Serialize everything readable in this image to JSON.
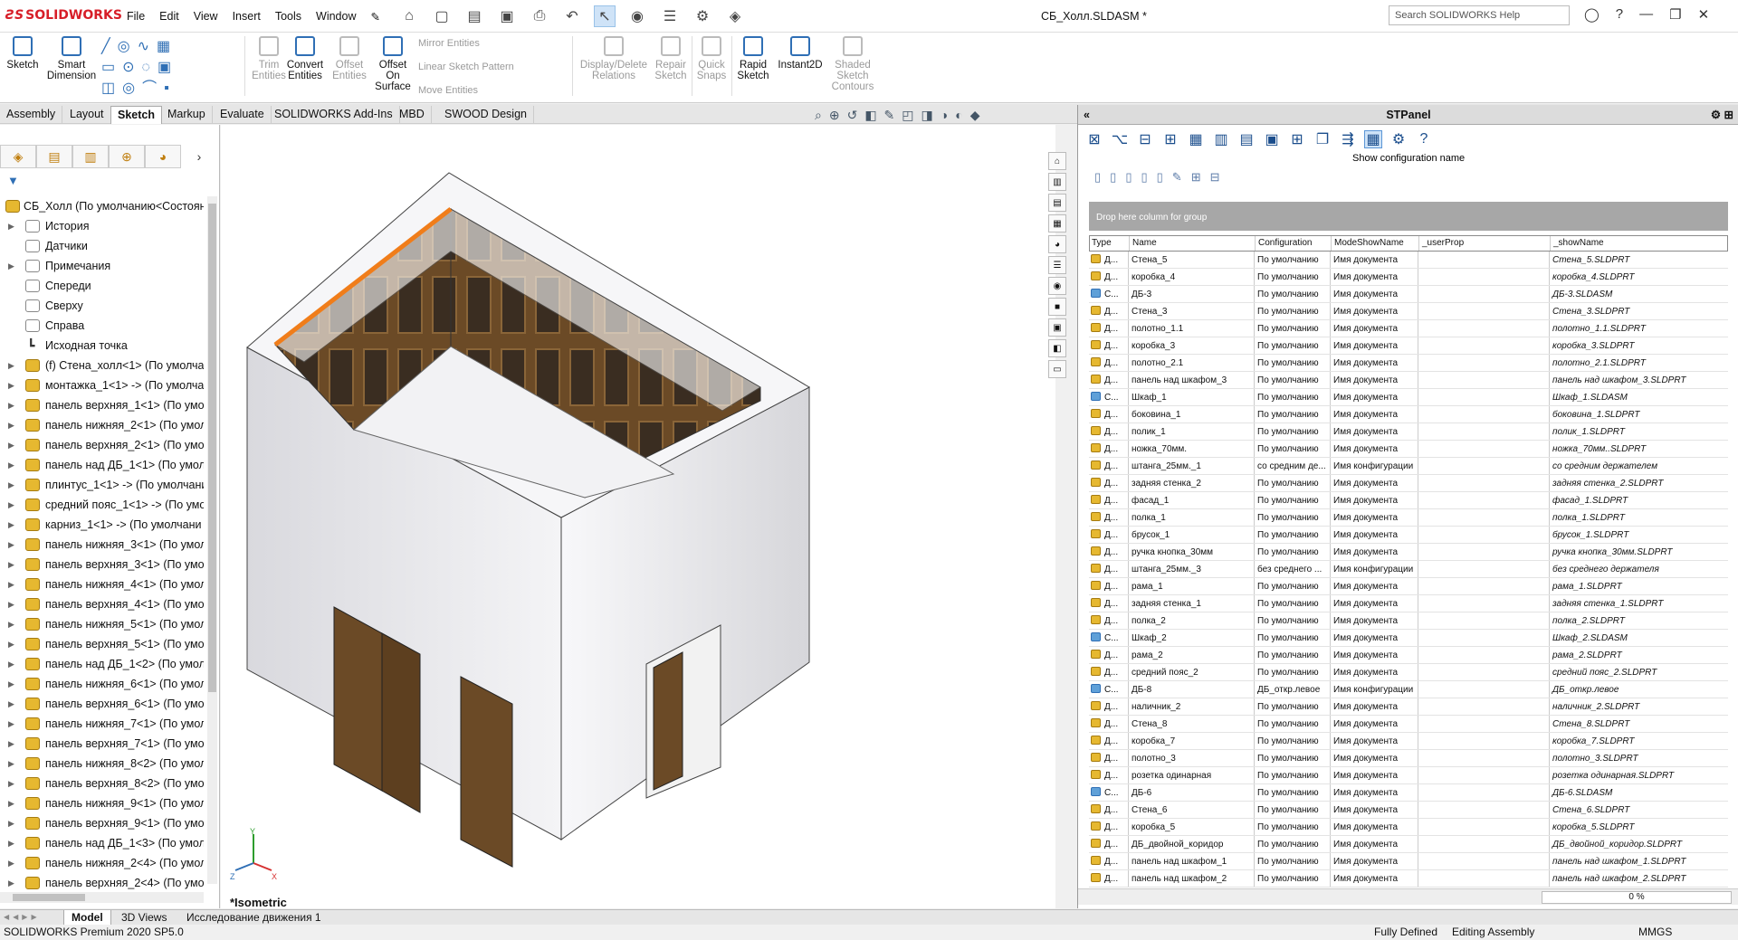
{
  "app": {
    "logo": "SOLIDWORKS",
    "title": "СБ_Холл.SLDASM *",
    "search_placeholder": "Search SOLIDWORKS Help"
  },
  "menu": [
    "File",
    "Edit",
    "View",
    "Insert",
    "Tools",
    "Window"
  ],
  "ribbon": {
    "sketch": "Sketch",
    "smart_dimension": "Smart Dimension",
    "trim": "Trim Entities",
    "convert": "Convert Entities",
    "offset": "Offset Entities",
    "offset_surface": "Offset On Surface",
    "mirror": "Mirror Entities",
    "linear_pattern": "Linear Sketch Pattern",
    "move": "Move Entities",
    "display_delete": "Display/Delete Relations",
    "repair": "Repair Sketch",
    "quick_snaps": "Quick Snaps",
    "rapid": "Rapid Sketch",
    "instant2d": "Instant2D",
    "shaded": "Shaded Sketch Contours"
  },
  "tabs": [
    "Assembly",
    "Layout",
    "Sketch",
    "Markup",
    "Evaluate",
    "SOLIDWORKS Add-Ins",
    "MBD",
    "SWOOD Design"
  ],
  "active_tab": "Sketch",
  "tree": {
    "root": "СБ_Холл  (По умолчанию<Состоян",
    "items": [
      {
        "label": "История",
        "icon": "history-icon",
        "exp": true
      },
      {
        "label": "Датчики",
        "icon": "sensor-icon",
        "exp": false
      },
      {
        "label": "Примечания",
        "icon": "annotations-icon",
        "exp": true
      },
      {
        "label": "Спереди",
        "icon": "plane-icon",
        "exp": false
      },
      {
        "label": "Сверху",
        "icon": "plane-icon",
        "exp": false
      },
      {
        "label": "Справа",
        "icon": "plane-icon",
        "exp": false
      },
      {
        "label": "Исходная точка",
        "icon": "origin-icon",
        "exp": false
      },
      {
        "label": "(f) Стена_холл<1> (По умолчан",
        "icon": "part-icon",
        "exp": true
      },
      {
        "label": "монтажка_1<1> -> (По умолча",
        "icon": "part-icon",
        "exp": true
      },
      {
        "label": "панель верхняя_1<1> (По умол",
        "icon": "part-icon",
        "exp": true
      },
      {
        "label": "панель нижняя_2<1> (По умол",
        "icon": "part-icon",
        "exp": true
      },
      {
        "label": "панель верхняя_2<1> (По умол",
        "icon": "part-icon",
        "exp": true
      },
      {
        "label": "панель над ДБ_1<1> (По умолч",
        "icon": "part-icon",
        "exp": true
      },
      {
        "label": "плинтус_1<1> -> (По умолчани",
        "icon": "part-icon",
        "exp": true
      },
      {
        "label": "средний пояс_1<1> -> (По умо.",
        "icon": "part-icon",
        "exp": true
      },
      {
        "label": "карниз_1<1> -> (По умолчани",
        "icon": "part-icon",
        "exp": true
      },
      {
        "label": "панель нижняя_3<1> (По умол",
        "icon": "part-icon",
        "exp": true
      },
      {
        "label": "панель верхняя_3<1> (По умол",
        "icon": "part-icon",
        "exp": true
      },
      {
        "label": "панель нижняя_4<1> (По умол",
        "icon": "part-icon",
        "exp": true
      },
      {
        "label": "панель верхняя_4<1> (По умол",
        "icon": "part-icon",
        "exp": true
      },
      {
        "label": "панель нижняя_5<1> (По умол",
        "icon": "part-icon",
        "exp": true
      },
      {
        "label": "панель верхняя_5<1> (По умол",
        "icon": "part-icon",
        "exp": true
      },
      {
        "label": "панель над ДБ_1<2> (По умолч",
        "icon": "part-icon",
        "exp": true
      },
      {
        "label": "панель нижняя_6<1> (По умол",
        "icon": "part-icon",
        "exp": true
      },
      {
        "label": "панель верхняя_6<1> (По умол",
        "icon": "part-icon",
        "exp": true
      },
      {
        "label": "панель нижняя_7<1> (По умол",
        "icon": "part-icon",
        "exp": true
      },
      {
        "label": "панель верхняя_7<1> (По умол",
        "icon": "part-icon",
        "exp": true
      },
      {
        "label": "панель нижняя_8<2> (По умол",
        "icon": "part-icon",
        "exp": true
      },
      {
        "label": "панель верхняя_8<2> (По умол",
        "icon": "part-icon",
        "exp": true
      },
      {
        "label": "панель нижняя_9<1> (По умол",
        "icon": "part-icon",
        "exp": true
      },
      {
        "label": "панель верхняя_9<1> (По умол",
        "icon": "part-icon",
        "exp": true
      },
      {
        "label": "панель над ДБ_1<3> (По умолч",
        "icon": "part-icon",
        "exp": true
      },
      {
        "label": "панель нижняя_2<4> (По умол",
        "icon": "part-icon",
        "exp": true
      },
      {
        "label": "панель верхняя_2<4> (По умол",
        "icon": "part-icon",
        "exp": true
      }
    ]
  },
  "viewport": {
    "view_label": "*Isometric",
    "axes": [
      "Y",
      "X",
      "Z"
    ]
  },
  "panel": {
    "title": "STPanel",
    "tooltip": "Show configuration name",
    "group_hint": "Drop here column for group",
    "columns": [
      "Type",
      "Name",
      "Configuration",
      "ModeShowName",
      "_userProp",
      "_showName"
    ],
    "rows": [
      {
        "t": "Д...",
        "a": false,
        "n": "Стена_5",
        "c": "По умолчанию",
        "m": "Имя документа",
        "s": "Стена_5.SLDPRT"
      },
      {
        "t": "Д...",
        "a": false,
        "n": "коробка_4",
        "c": "По умолчанию",
        "m": "Имя документа",
        "s": "коробка_4.SLDPRT"
      },
      {
        "t": "С...",
        "a": true,
        "n": "ДБ-3",
        "c": "По умолчанию",
        "m": "Имя документа",
        "s": "ДБ-3.SLDASM"
      },
      {
        "t": "Д...",
        "a": false,
        "n": "Стена_3",
        "c": "По умолчанию",
        "m": "Имя документа",
        "s": "Стена_3.SLDPRT"
      },
      {
        "t": "Д...",
        "a": false,
        "n": "полотно_1.1",
        "c": "По умолчанию",
        "m": "Имя документа",
        "s": "полотно_1.1.SLDPRT"
      },
      {
        "t": "Д...",
        "a": false,
        "n": "коробка_3",
        "c": "По умолчанию",
        "m": "Имя документа",
        "s": "коробка_3.SLDPRT"
      },
      {
        "t": "Д...",
        "a": false,
        "n": "полотно_2.1",
        "c": "По умолчанию",
        "m": "Имя документа",
        "s": "полотно_2.1.SLDPRT"
      },
      {
        "t": "Д...",
        "a": false,
        "n": "панель над шкафом_3",
        "c": "По умолчанию",
        "m": "Имя документа",
        "s": "панель над шкафом_3.SLDPRT"
      },
      {
        "t": "С...",
        "a": true,
        "n": "Шкаф_1",
        "c": "По умолчанию",
        "m": "Имя документа",
        "s": "Шкаф_1.SLDASM"
      },
      {
        "t": "Д...",
        "a": false,
        "n": "боковина_1",
        "c": "По умолчанию",
        "m": "Имя документа",
        "s": "боковина_1.SLDPRT"
      },
      {
        "t": "Д...",
        "a": false,
        "n": "полик_1",
        "c": "По умолчанию",
        "m": "Имя документа",
        "s": "полик_1.SLDPRT"
      },
      {
        "t": "Д...",
        "a": false,
        "n": "ножка_70мм.",
        "c": "По умолчанию",
        "m": "Имя документа",
        "s": "ножка_70мм..SLDPRT"
      },
      {
        "t": "Д...",
        "a": false,
        "n": "штанга_25мм._1",
        "c": "со средним де...",
        "m": "Имя конфигурации",
        "s": "со средним держателем"
      },
      {
        "t": "Д...",
        "a": false,
        "n": "задняя стенка_2",
        "c": "По умолчанию",
        "m": "Имя документа",
        "s": "задняя стенка_2.SLDPRT"
      },
      {
        "t": "Д...",
        "a": false,
        "n": "фасад_1",
        "c": "По умолчанию",
        "m": "Имя документа",
        "s": "фасад_1.SLDPRT"
      },
      {
        "t": "Д...",
        "a": false,
        "n": "полка_1",
        "c": "По умолчанию",
        "m": "Имя документа",
        "s": "полка_1.SLDPRT"
      },
      {
        "t": "Д...",
        "a": false,
        "n": "брусок_1",
        "c": "По умолчанию",
        "m": "Имя документа",
        "s": "брусок_1.SLDPRT"
      },
      {
        "t": "Д...",
        "a": false,
        "n": "ручка кнопка_30мм",
        "c": "По умолчанию",
        "m": "Имя документа",
        "s": "ручка кнопка_30мм.SLDPRT"
      },
      {
        "t": "Д...",
        "a": false,
        "n": "штанга_25мм._3",
        "c": "без среднего ...",
        "m": "Имя конфигурации",
        "s": "без среднего держателя"
      },
      {
        "t": "Д...",
        "a": false,
        "n": "рама_1",
        "c": "По умолчанию",
        "m": "Имя документа",
        "s": "рама_1.SLDPRT"
      },
      {
        "t": "Д...",
        "a": false,
        "n": "задняя стенка_1",
        "c": "По умолчанию",
        "m": "Имя документа",
        "s": "задняя стенка_1.SLDPRT"
      },
      {
        "t": "Д...",
        "a": false,
        "n": "полка_2",
        "c": "По умолчанию",
        "m": "Имя документа",
        "s": "полка_2.SLDPRT"
      },
      {
        "t": "С...",
        "a": true,
        "n": "Шкаф_2",
        "c": "По умолчанию",
        "m": "Имя документа",
        "s": "Шкаф_2.SLDASM"
      },
      {
        "t": "Д...",
        "a": false,
        "n": "рама_2",
        "c": "По умолчанию",
        "m": "Имя документа",
        "s": "рама_2.SLDPRT"
      },
      {
        "t": "Д...",
        "a": false,
        "n": "средний пояс_2",
        "c": "По умолчанию",
        "m": "Имя документа",
        "s": "средний пояс_2.SLDPRT"
      },
      {
        "t": "С...",
        "a": true,
        "n": "ДБ-8",
        "c": "ДБ_откр.левое",
        "m": "Имя конфигурации",
        "s": "ДБ_откр.левое"
      },
      {
        "t": "Д...",
        "a": false,
        "n": "наличник_2",
        "c": "По умолчанию",
        "m": "Имя документа",
        "s": "наличник_2.SLDPRT"
      },
      {
        "t": "Д...",
        "a": false,
        "n": "Стена_8",
        "c": "По умолчанию",
        "m": "Имя документа",
        "s": "Стена_8.SLDPRT"
      },
      {
        "t": "Д...",
        "a": false,
        "n": "коробка_7",
        "c": "По умолчанию",
        "m": "Имя документа",
        "s": "коробка_7.SLDPRT"
      },
      {
        "t": "Д...",
        "a": false,
        "n": "полотно_3",
        "c": "По умолчанию",
        "m": "Имя документа",
        "s": "полотно_3.SLDPRT"
      },
      {
        "t": "Д...",
        "a": false,
        "n": "розетка одинарная",
        "c": "По умолчанию",
        "m": "Имя документа",
        "s": "розетка одинарная.SLDPRT"
      },
      {
        "t": "С...",
        "a": true,
        "n": "ДБ-6",
        "c": "По умолчанию",
        "m": "Имя документа",
        "s": "ДБ-6.SLDASM"
      },
      {
        "t": "Д...",
        "a": false,
        "n": "Стена_6",
        "c": "По умолчанию",
        "m": "Имя документа",
        "s": "Стена_6.SLDPRT"
      },
      {
        "t": "Д...",
        "a": false,
        "n": "коробка_5",
        "c": "По умолчанию",
        "m": "Имя документа",
        "s": "коробка_5.SLDPRT"
      },
      {
        "t": "Д...",
        "a": false,
        "n": "ДБ_двойной_коридор",
        "c": "По умолчанию",
        "m": "Имя документа",
        "s": "ДБ_двойной_коридор.SLDPRT"
      },
      {
        "t": "Д...",
        "a": false,
        "n": "панель над шкафом_1",
        "c": "По умолчанию",
        "m": "Имя документа",
        "s": "панель над шкафом_1.SLDPRT"
      },
      {
        "t": "Д...",
        "a": false,
        "n": "панель над шкафом_2",
        "c": "По умолчанию",
        "m": "Имя документа",
        "s": "панель над шкафом_2.SLDPRT"
      }
    ],
    "progress": "0 %"
  },
  "bottom_tabs": [
    "Model",
    "3D Views",
    "Исследование движения 1"
  ],
  "status": {
    "left": "SOLIDWORKS Premium 2020 SP5.0",
    "defined": "Fully Defined",
    "mode": "Editing Assembly",
    "units": "MMGS"
  },
  "colors": {
    "brand": "#d71e28",
    "accent": "#2f6fb5",
    "wood": "#6b4a26",
    "edge": "#f07d1a"
  }
}
